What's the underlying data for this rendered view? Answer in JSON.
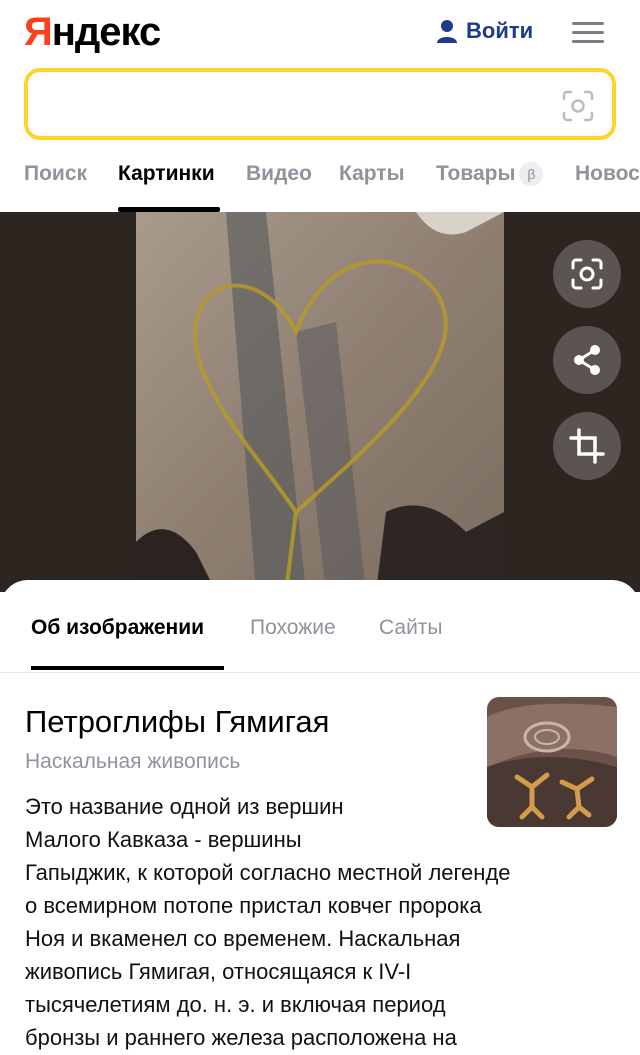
{
  "header": {
    "logo_first": "Я",
    "logo_rest": "ндекс",
    "login_label": "Войти"
  },
  "search": {
    "value": "",
    "placeholder": ""
  },
  "tabs": [
    {
      "label": "Поиск"
    },
    {
      "label": "Картинки",
      "active": true
    },
    {
      "label": "Видео"
    },
    {
      "label": "Карты"
    },
    {
      "label": "Товары",
      "badge": "β"
    },
    {
      "label": "Новости"
    }
  ],
  "viewer": {
    "actions": [
      "lens-icon",
      "share-icon",
      "crop-icon"
    ]
  },
  "panel": {
    "tabs": [
      {
        "label": "Об изображении",
        "active": true
      },
      {
        "label": "Похожие"
      },
      {
        "label": "Сайты"
      }
    ],
    "title": "Петроглифы Гямигая",
    "subtitle": "Наскальная живопись",
    "description_lines": [
      "Это название одной из вершин",
      "Малого Кавказа - вершины",
      "Гапыджик, к которой согласно местной легенде",
      "о всемирном потопе пристал ковчег пророка",
      "Ноя и вкаменел со временем. Наскальная",
      "живопись Гямигая, относящаяся к IV-I",
      "тысячелетиям до. н. э. и включая период",
      "бронзы и раннего железа расположена на"
    ]
  },
  "colors": {
    "brand_red": "#fc3f1d",
    "search_border": "#fdd32c",
    "login_blue": "#1e3a8a",
    "muted_text": "#8e939c"
  }
}
